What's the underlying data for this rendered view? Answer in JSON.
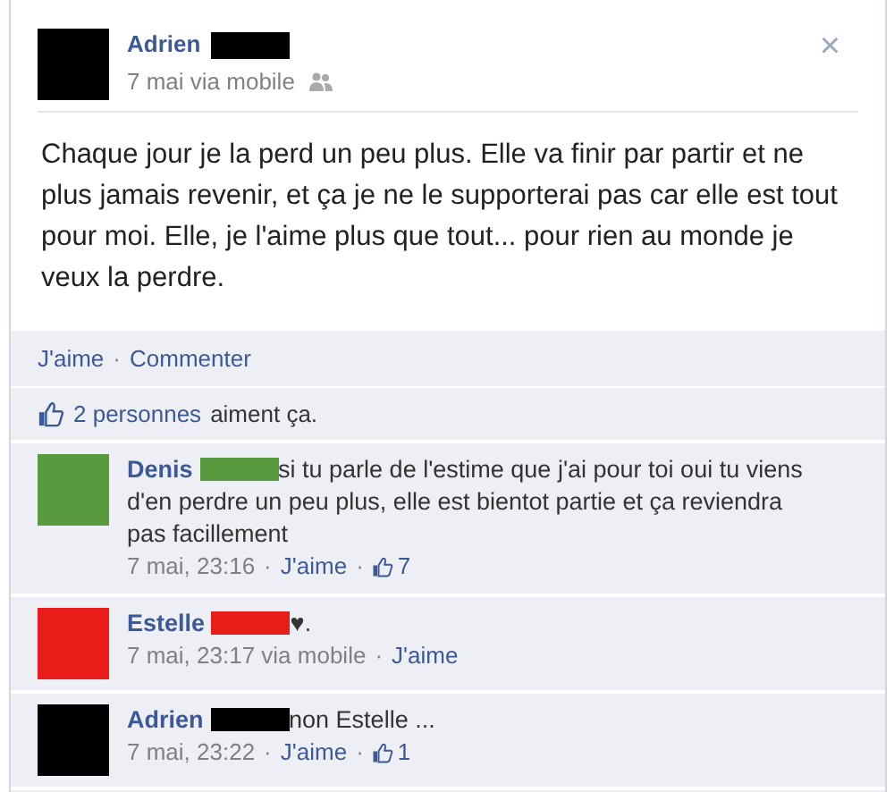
{
  "post": {
    "author": "Adrien",
    "meta": "7 mai via mobile",
    "body": "Chaque jour je la perd un peu plus. Elle va finir par partir et ne plus jamais revenir, et ça je ne le supporterai pas car elle est tout pour moi. Elle, je l'aime plus que tout... pour rien au monde je veux la perdre.",
    "close": "×"
  },
  "actions": [
    {
      "kind": "link",
      "text": "J'aime"
    },
    {
      "kind": "sep",
      "text": "·"
    },
    {
      "kind": "link",
      "text": "Commenter"
    }
  ],
  "likes": {
    "count_link": "2 personnes",
    "rest": "aiment ça."
  },
  "comments": [
    {
      "author": "Denis",
      "color": "#5a9a3e",
      "text": "si tu parle de l'estime que j'ai pour toi oui tu viens d'en perdre un peu plus, elle est bientot partie et ça reviendra pas facillement",
      "meta": [
        {
          "kind": "text",
          "text": "7 mai, 23:16"
        },
        {
          "kind": "sep",
          "text": "·"
        },
        {
          "kind": "link",
          "text": "J'aime"
        },
        {
          "kind": "sep",
          "text": "·"
        },
        {
          "kind": "likes",
          "text": "7"
        }
      ]
    },
    {
      "author": "Estelle",
      "color": "#e81c18",
      "text": "♥.",
      "meta": [
        {
          "kind": "text",
          "text": "7 mai, 23:17 via mobile"
        },
        {
          "kind": "sep",
          "text": "·"
        },
        {
          "kind": "link",
          "text": "J'aime"
        }
      ]
    },
    {
      "author": "Adrien",
      "color": "#000000",
      "text": "non Estelle ...",
      "meta": [
        {
          "kind": "text",
          "text": "7 mai, 23:22"
        },
        {
          "kind": "sep",
          "text": "·"
        },
        {
          "kind": "link",
          "text": "J'aime"
        },
        {
          "kind": "sep",
          "text": "·"
        },
        {
          "kind": "likes",
          "text": "1"
        }
      ]
    }
  ]
}
